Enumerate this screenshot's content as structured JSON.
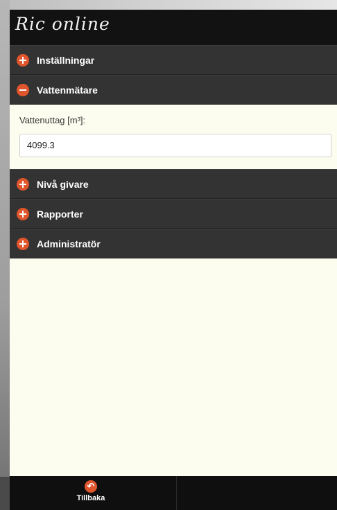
{
  "app": {
    "title": "Ric online"
  },
  "menu": {
    "items": [
      {
        "label": "Inställningar"
      },
      {
        "label": "Vattenmätare"
      },
      {
        "label": "Nivå givare"
      },
      {
        "label": "Rapporter"
      },
      {
        "label": "Administratör"
      }
    ]
  },
  "vattenmatare": {
    "field_label": "Vattenuttag [m³]:",
    "value": "4099.3"
  },
  "footer": {
    "back_label": "Tillbaka"
  },
  "colors": {
    "accent": "#e0552c",
    "bar": "#333333",
    "background": "#fdfdef"
  }
}
